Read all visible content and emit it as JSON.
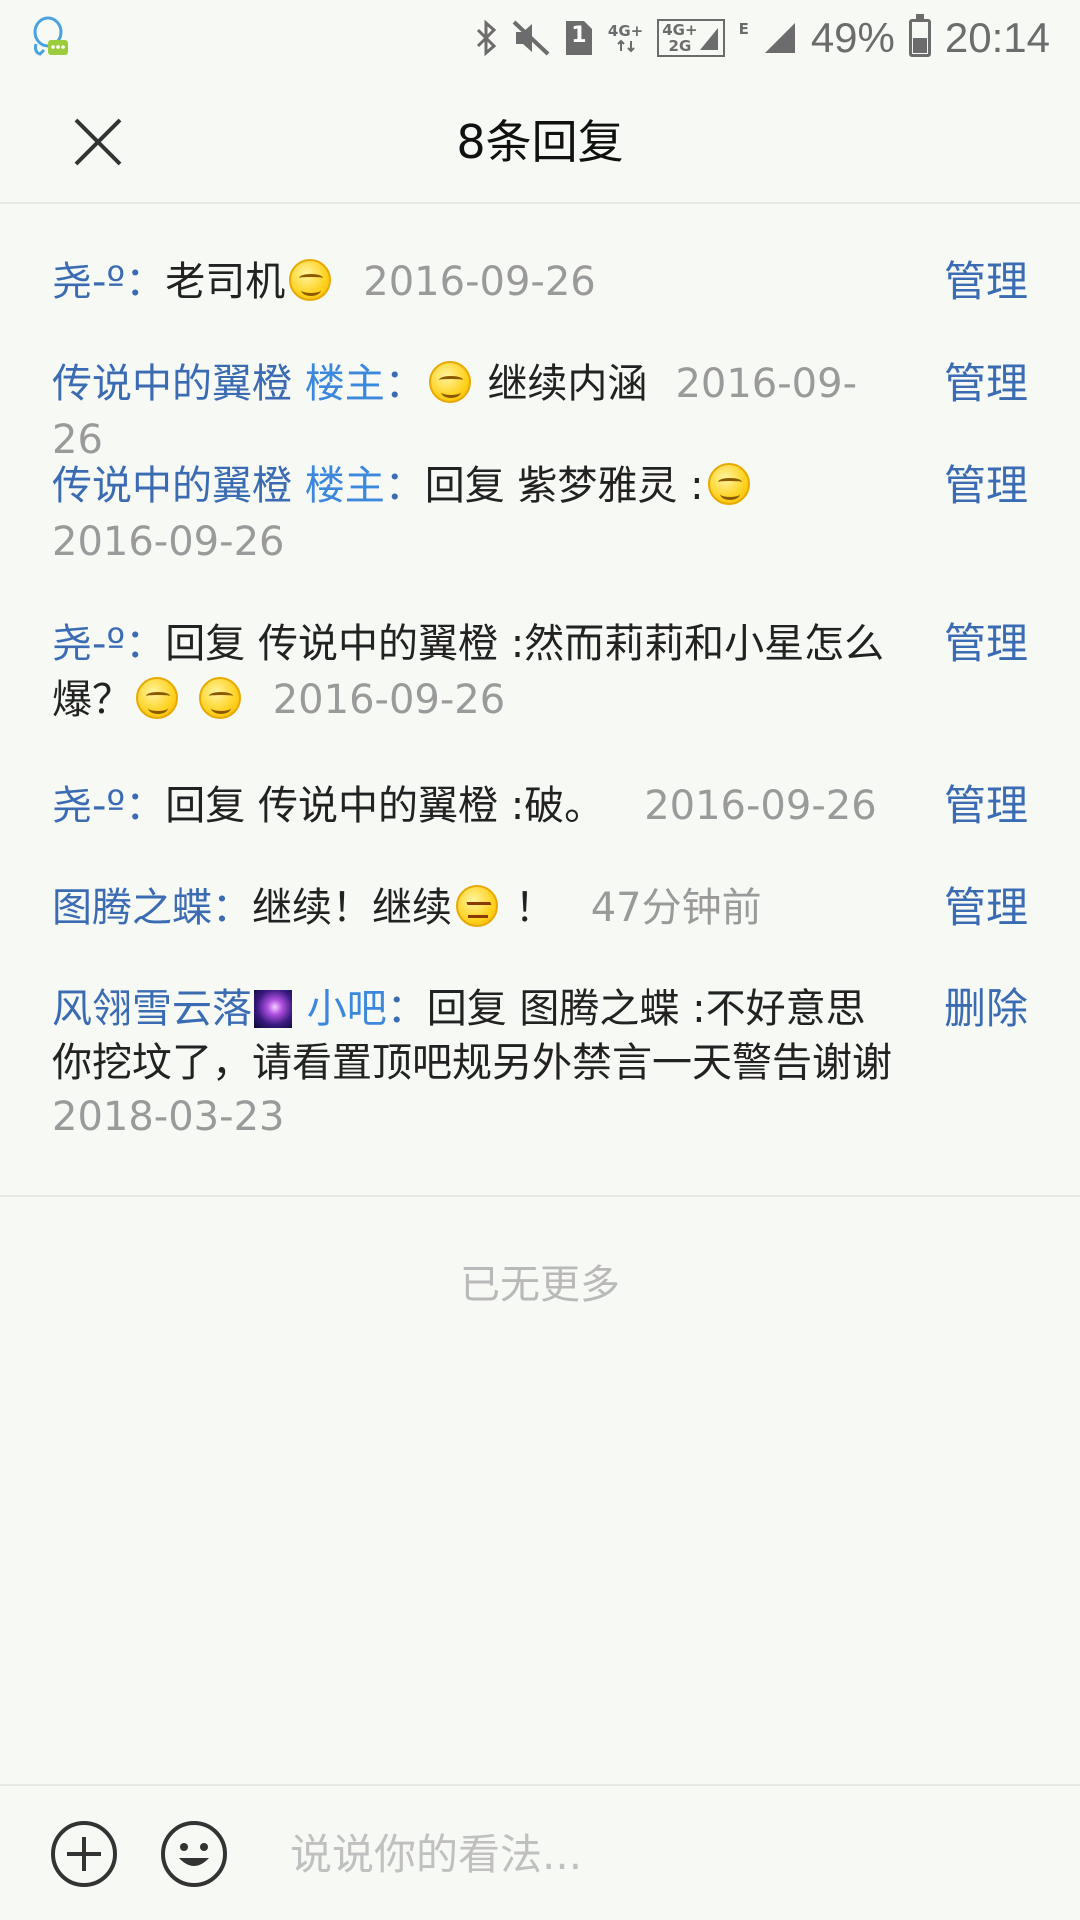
{
  "status_bar": {
    "net_top": "4G+",
    "net_bottom_a": "4G+",
    "net_bottom_b": "2G",
    "edge_label": "E",
    "battery_text": "49%",
    "clock": "20:14",
    "sim_label": "1"
  },
  "header": {
    "title": "8条回复"
  },
  "replies": [
    {
      "user": "尧-º",
      "role": "",
      "content_before": "老司机",
      "content_after": "",
      "time": "2016-09-26",
      "action": "管理"
    },
    {
      "user": "传说中的翼橙",
      "role": "楼主",
      "content_before": "",
      "content_after": "继续内涵",
      "time": "2016-09-26",
      "action": "管理"
    },
    {
      "user": "传说中的翼橙",
      "role": "楼主",
      "content_before": "回复 紫梦雅灵 :",
      "content_after": "",
      "time": "2016-09-26",
      "action": "管理"
    },
    {
      "user": "尧-º",
      "role": "",
      "content_before": "回复 传说中的翼橙 :然而莉莉和小星怎么爆？",
      "content_after": "",
      "time": "2016-09-26",
      "action": "管理"
    },
    {
      "user": "尧-º",
      "role": "",
      "content_before": "回复 传说中的翼橙 :破。",
      "content_after": "",
      "time": "2016-09-26",
      "action": "管理"
    },
    {
      "user": "图腾之蝶",
      "role": "",
      "content_before": "继续！继续",
      "content_after": "！",
      "time": "47分钟前",
      "action": "管理"
    },
    {
      "user": "风翎雪云落",
      "role": "小吧",
      "content_before": "回复 图腾之蝶 :不好意思你挖坟了，请看置顶吧规另外禁言一天警告谢谢",
      "content_after": "",
      "time": "2018-03-23",
      "action": "删除"
    }
  ],
  "separator": "：",
  "no_more": "已无更多",
  "composer": {
    "placeholder": "说说你的看法..."
  },
  "colors": {
    "link": "#3b6cb3",
    "role": "#3b88dd",
    "time": "#9a9a9a",
    "background": "#f6f9f4"
  }
}
